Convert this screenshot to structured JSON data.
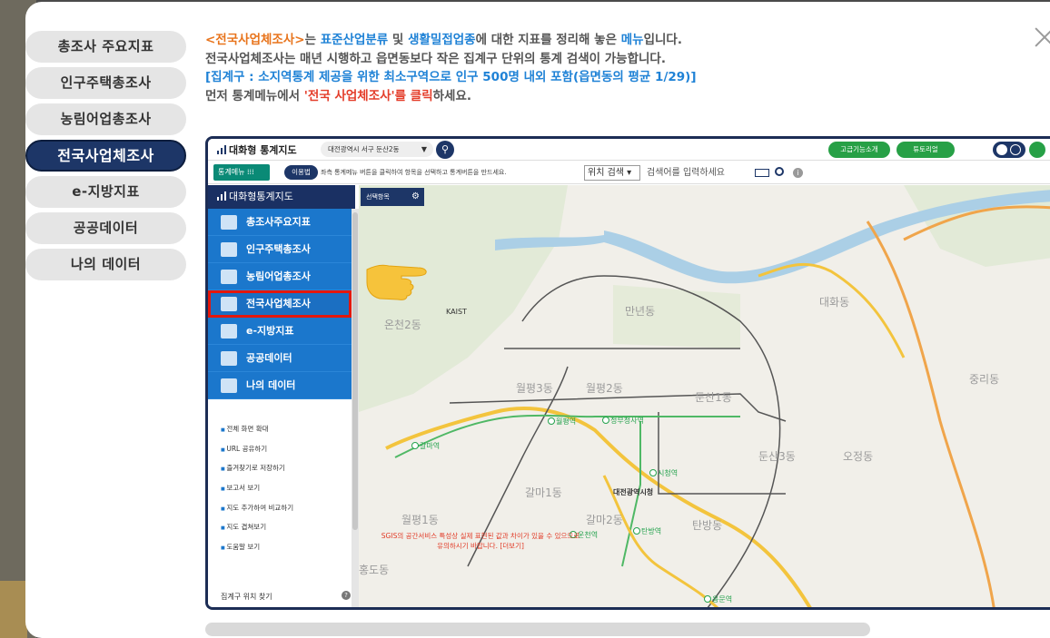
{
  "side_tabs": [
    {
      "label": "총조사 주요지표",
      "active": false
    },
    {
      "label": "인구주택총조사",
      "active": false
    },
    {
      "label": "농림어업총조사",
      "active": false
    },
    {
      "label": "전국사업체조사",
      "active": true
    },
    {
      "label": "e-지방지표",
      "active": false
    },
    {
      "label": "공공데이터",
      "active": false
    },
    {
      "label": "나의 데이터",
      "active": false
    }
  ],
  "intro": {
    "line1_a": "<전국사업체조사>",
    "line1_b": "는 ",
    "line1_c": "표준산업분류",
    "line1_d": " 및 ",
    "line1_e": "생활밀접업종",
    "line1_f": "에 대한 지표를 정리해 놓은 ",
    "line1_g": "메뉴",
    "line1_h": "입니다.",
    "line2": "전국사업체조사는 매년 시행하고 읍면동보다 작은 집계구 단위의 통계 검색이 가능합니다.",
    "line3": "[집계구 : 소지역통계 제공을 위한 최소구역으로 인구 500명 내외 포함(읍면동의 평균 1/29)]",
    "line4_a": "먼저 통계메뉴에서 ",
    "line4_b": "'전국 사업체조사'를 클릭",
    "line4_c": "하세요."
  },
  "screenshot": {
    "app_title": "대화형 통계지도",
    "location": "대전광역시 서구 둔산2동",
    "btn_features": "고급기능소개",
    "btn_tutorial": "튜토리얼",
    "menu_btn": "통계메뉴",
    "usage_btn": "이용법",
    "hint": "좌측 통계메뉴 버튼을 클릭하여 항목을 선택하고 통계버튼을 만드세요.",
    "pos_select": "위치 검색",
    "search_placeholder": "검색어를 입력하세요",
    "panel_title": "대화형통계지도",
    "menu_items": [
      "총조사주요지표",
      "인구주택총조사",
      "농림어업총조사",
      "전국사업체조사",
      "e-지방지표",
      "공공데이터",
      "나의 데이터"
    ],
    "links": [
      "전체 화면 확대",
      "URL 공유하기",
      "즐겨찾기로 저장하기",
      "보고서 보기",
      "지도 추가하여 비교하기",
      "지도 겹쳐보기",
      "도움말 보기"
    ],
    "panel_footer": "집계구 위치 찾기",
    "region_btn": "선택항목",
    "notice": "SGIS의 공간서비스 특성상 실제 표현된 값과 차이가 있을 수 있으므로 유의하시기 바랍니다. [더보기]"
  },
  "map_labels": {
    "dong_1": "만년동",
    "dong_2": "월평3동",
    "dong_3": "월평2동",
    "dong_4": "둔산1동",
    "dong_5": "둔산3동",
    "dong_6": "갈마1동",
    "dong_7": "갈마2동",
    "dong_8": "탄방동",
    "dong_9": "월평1동",
    "dong_10": "대화동",
    "dong_11": "오정동",
    "dong_12": "중리동",
    "dong_13": "홍도동",
    "dong_14": "온천2동",
    "kaist": "KAIST",
    "city_hall": "대전광역시청",
    "st_1": "갈마역",
    "st_2": "정부청사역",
    "st_3": "시청역",
    "st_4": "탄방역",
    "st_5": "용문역",
    "st_6": "월평역",
    "st_7": "운천역"
  }
}
